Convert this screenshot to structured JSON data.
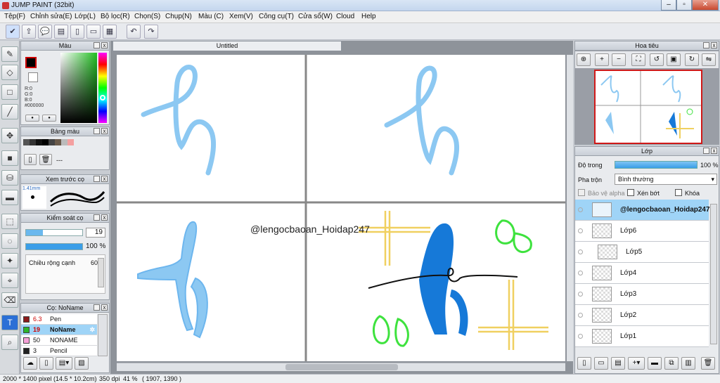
{
  "app": {
    "title": "JUMP PAINT (32bit)"
  },
  "menu": [
    "Tệp(F)",
    "Chỉnh sửa(E)",
    "Lớp(L)",
    "Bộ lọc(R)",
    "Chọn(S)",
    "Chụp(N)",
    "Màu (C)",
    "Xem(V)",
    "Công cụ(T)",
    "Cửa sổ(W)",
    "Cloud",
    "Help"
  ],
  "canvas": {
    "tab_title": "Untitled",
    "watermark": "@lengocbaoan_Hoidap247"
  },
  "color_panel": {
    "title": "Màu",
    "r": "R:0",
    "g": "G:0",
    "b": "B:0",
    "hex": "#000000"
  },
  "swatch_panel": {
    "title": "Bảng màu",
    "dash": "---"
  },
  "brush_preview": {
    "title": "Xem trước cọ",
    "size": "1.41mm"
  },
  "brush_control": {
    "title": "Kiểm soát cọ",
    "size": "19",
    "opacity": "100 %",
    "width_label": "Chiều rộng cạnh",
    "width_value": "60"
  },
  "brush_list": {
    "title": "Cọ: NoName",
    "items": [
      {
        "size": "6.3",
        "name": "Pen",
        "color": "#8b1a1a"
      },
      {
        "size": "19",
        "name": "NoName",
        "color": "#2bb52b",
        "selected": true
      },
      {
        "size": "50",
        "name": "NONAME",
        "color": "#f6a0d8"
      },
      {
        "size": "3",
        "name": "Pencil",
        "color": "#222222"
      }
    ]
  },
  "navigator": {
    "title": "Hoa tiêu"
  },
  "layers": {
    "title": "Lớp",
    "opacity_label": "Độ trong",
    "opacity_value": "100 %",
    "blend_label": "Pha trộn",
    "blend_value": "Bình thường",
    "protect_alpha": "Bảo vệ alpha",
    "clip": "Xén bớt",
    "lock": "Khóa",
    "items": [
      {
        "name": "@lengocbaoan_Hoidap247",
        "selected": true
      },
      {
        "name": "Lớp6"
      },
      {
        "name": "Lớp5"
      },
      {
        "name": "Lớp4"
      },
      {
        "name": "Lớp3"
      },
      {
        "name": "Lớp2"
      },
      {
        "name": "Lớp1"
      }
    ]
  },
  "status": {
    "size": "2000 * 1400 pixel",
    "cm": "(14.5 * 10.2cm)",
    "dpi": "350 dpi",
    "zoom": "41 %",
    "coords": "( 1907, 1390 )"
  }
}
